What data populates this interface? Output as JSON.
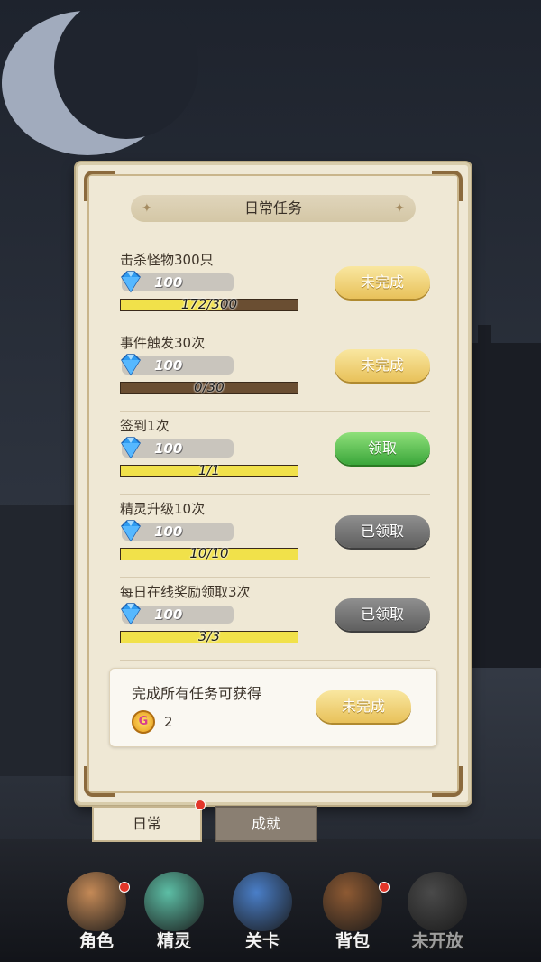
{
  "panel": {
    "title": "日常任务",
    "tasks": [
      {
        "name": "击杀怪物300只",
        "reward": "100",
        "progress_text": "172/300",
        "progress": 0.573,
        "button": "未完成",
        "state": "pending"
      },
      {
        "name": "事件触发30次",
        "reward": "100",
        "progress_text": "0/30",
        "progress": 0.0,
        "button": "未完成",
        "state": "pending"
      },
      {
        "name": "签到1次",
        "reward": "100",
        "progress_text": "1/1",
        "progress": 1.0,
        "button": "领取",
        "state": "claimable"
      },
      {
        "name": "精灵升级10次",
        "reward": "100",
        "progress_text": "10/10",
        "progress": 1.0,
        "button": "已领取",
        "state": "claimed"
      },
      {
        "name": "每日在线奖励领取3次",
        "reward": "100",
        "progress_text": "3/3",
        "progress": 1.0,
        "button": "已领取",
        "state": "claimed"
      }
    ],
    "bonus": {
      "text": "完成所有任务可获得",
      "coin_count": "2",
      "coin_glyph": "G",
      "button": "未完成"
    }
  },
  "tabs": {
    "daily": "日常",
    "achievements": "成就"
  },
  "nav": [
    {
      "label": "角色",
      "icon": "character-icon",
      "color": "#c58a57"
    },
    {
      "label": "精灵",
      "icon": "spirit-icon",
      "color": "#5dbfa6"
    },
    {
      "label": "关卡",
      "icon": "stage-icon",
      "color": "#4a7fc9"
    },
    {
      "label": "背包",
      "icon": "backpack-icon",
      "color": "#8e5a33"
    },
    {
      "label": "未开放",
      "icon": "locked-icon",
      "color": "#4a4a4a"
    }
  ],
  "colors": {
    "progress_fill": "#f1e14a",
    "progress_empty": "#6a4e32",
    "panel": "#efe8d5"
  }
}
